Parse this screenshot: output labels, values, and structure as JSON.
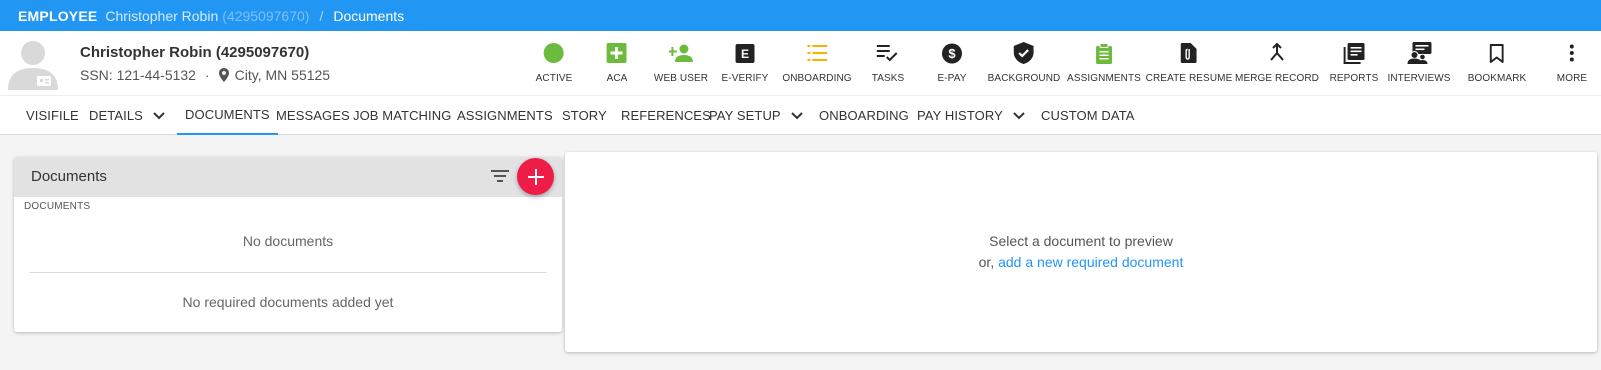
{
  "breadcrumb": {
    "entity": "EMPLOYEE",
    "name": "Christopher Robin",
    "id": "(4295097670)",
    "separator": "/",
    "page": "Documents"
  },
  "header": {
    "name": "Christopher Robin (4295097670)",
    "ssn": "SSN: 121-44-5132",
    "dot": "·",
    "location": "City, MN 55125"
  },
  "actions": [
    {
      "label": "ACTIVE",
      "icon": "active-status-icon",
      "color": "#6cbb3c"
    },
    {
      "label": "ACA",
      "icon": "aca-plus-icon",
      "color": "#6cbb3c"
    },
    {
      "label": "WEB USER",
      "icon": "add-user-icon",
      "color": "#6cbb3c"
    },
    {
      "label": "E-VERIFY",
      "icon": "e-verify-icon",
      "color": "#222222"
    },
    {
      "label": "ONBOARDING",
      "icon": "onboarding-list-icon",
      "color": "#f5b400"
    },
    {
      "label": "TASKS",
      "icon": "tasks-icon",
      "color": "#222222"
    },
    {
      "label": "E-PAY",
      "icon": "dollar-icon",
      "color": "#222222"
    },
    {
      "label": "BACKGROUND",
      "icon": "shield-check-icon",
      "color": "#222222"
    },
    {
      "label": "ASSIGNMENTS",
      "icon": "clipboard-icon",
      "color": "#6cbb3c"
    },
    {
      "label": "CREATE RESUME",
      "icon": "resume-attach-icon",
      "color": "#222222"
    },
    {
      "label": "MERGE RECORD",
      "icon": "merge-icon",
      "color": "#222222"
    },
    {
      "label": "REPORTS",
      "icon": "reports-icon",
      "color": "#222222"
    },
    {
      "label": "INTERVIEWS",
      "icon": "interviews-icon",
      "color": "#222222"
    },
    {
      "label": "BOOKMARK",
      "icon": "bookmark-icon",
      "color": "#222222"
    },
    {
      "label": "MORE",
      "icon": "more-vert-icon",
      "color": "#222222"
    }
  ],
  "tabs": [
    {
      "label": "VISIFILE"
    },
    {
      "label": "DETAILS"
    },
    {
      "label": "DOCUMENTS"
    },
    {
      "label": "MESSAGES"
    },
    {
      "label": "JOB MATCHING"
    },
    {
      "label": "ASSIGNMENTS"
    },
    {
      "label": "STORY"
    },
    {
      "label": "REFERENCES"
    },
    {
      "label": "PAY SETUP"
    },
    {
      "label": "ONBOARDING"
    },
    {
      "label": "PAY HISTORY"
    },
    {
      "label": "CUSTOM DATA"
    }
  ],
  "active_tab": "DOCUMENTS",
  "documents_panel": {
    "title": "Documents",
    "section_label": "DOCUMENTS",
    "empty_documents": "No documents",
    "empty_required": "No required documents added yet"
  },
  "preview_panel": {
    "message": "Select a document to preview",
    "or_text": "or,",
    "link": "add a new required document"
  },
  "colors": {
    "brand_blue": "#2196f3",
    "accent_red": "#ee1d48",
    "green": "#6cbb3c",
    "yellow": "#f5b400"
  }
}
